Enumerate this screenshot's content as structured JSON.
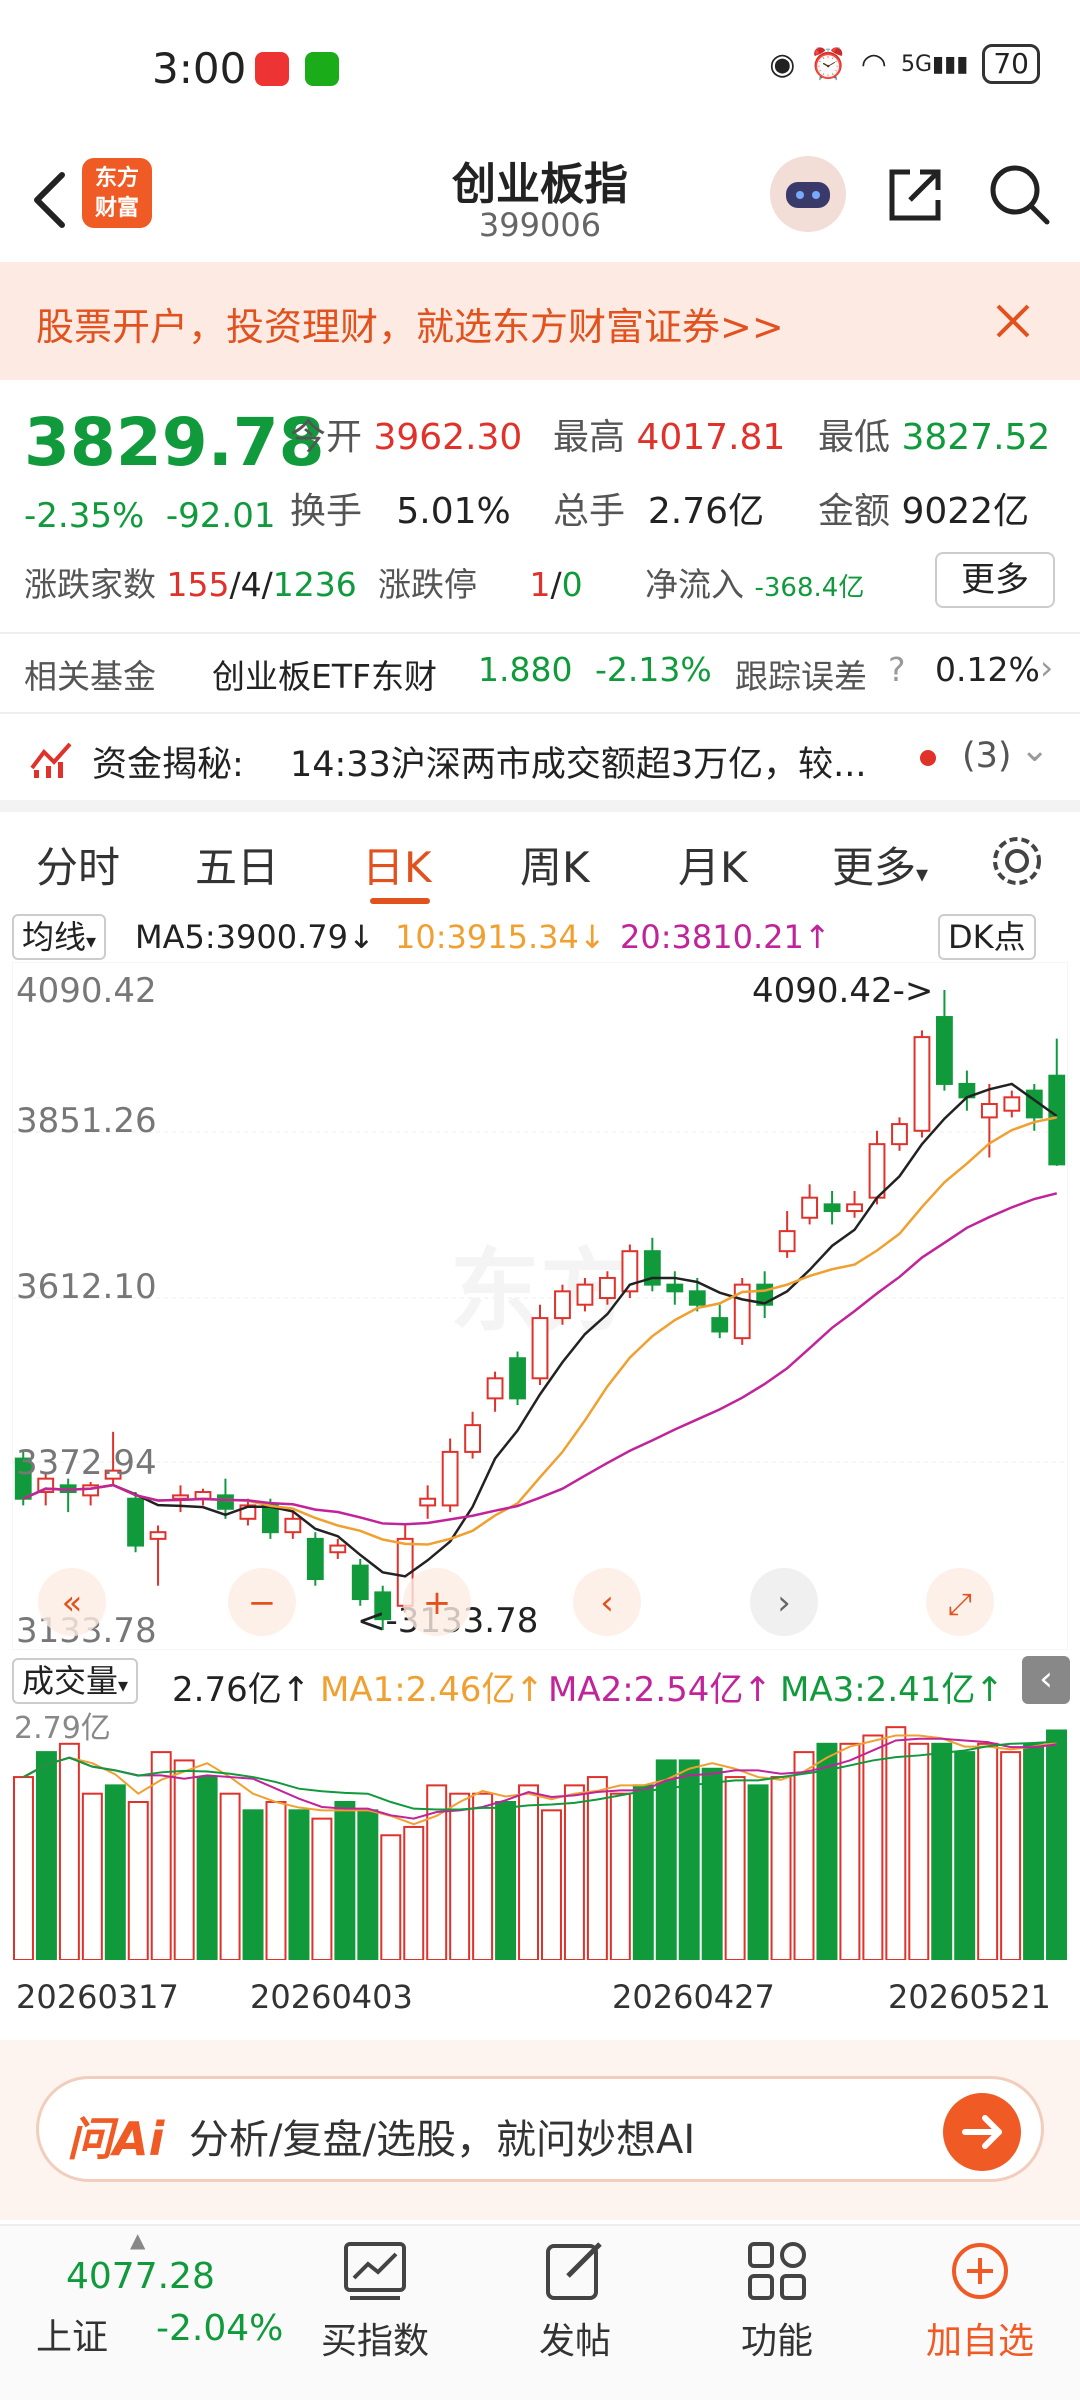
{
  "status_bar": {
    "time": "3:00",
    "network": "5G",
    "battery": "70"
  },
  "header": {
    "title": "创业板指",
    "code": "399006",
    "logo_text_1": "东方",
    "logo_text_2": "财富"
  },
  "promo": {
    "text": "股票开户，投资理财，就选东方财富证券>>"
  },
  "quote": {
    "price": "3829.78",
    "change_pct": "-2.35%",
    "change_abs": "-92.01",
    "open_label": "今开",
    "open": "3962.30",
    "high_label": "最高",
    "high": "4017.81",
    "low_label": "最低",
    "low": "3827.52",
    "turnover_label": "换手",
    "turnover": "5.01%",
    "volume_label": "总手",
    "volume": "2.76亿",
    "amount_label": "金额",
    "amount": "9022亿",
    "breadth_label": "涨跌家数",
    "breadth_up": "155",
    "breadth_flat": "4",
    "breadth_down": "1236",
    "limit_label": "涨跌停",
    "limit_up": "1",
    "limit_down": "0",
    "netflow_label": "净流入",
    "netflow": "-368.4亿",
    "more_label": "更多"
  },
  "fund": {
    "label": "相关基金",
    "name": "创业板ETF东财",
    "price": "1.880",
    "change": "-2.13%",
    "tracking_label": "跟踪误差",
    "tracking_value": "0.12%"
  },
  "news": {
    "label": "资金揭秘:",
    "text": "14:33沪深两市成交额超3万亿，较...",
    "count": "(3)"
  },
  "tabs": [
    "分时",
    "五日",
    "日K",
    "周K",
    "月K",
    "更多"
  ],
  "ma_legend": {
    "selector": "均线",
    "ma5": "MA5:3900.79",
    "ma10": "10:3915.34",
    "ma20": "20:3810.21",
    "dk": "DK点"
  },
  "y_ticks": [
    "4090.42",
    "3851.26",
    "3612.10",
    "3372.94",
    "3133.78"
  ],
  "annotations": {
    "high": "4090.42->",
    "low": "<-3133.78"
  },
  "volume_legend": {
    "selector": "成交量",
    "vol": "2.76亿",
    "ma1": "MA1:2.46亿",
    "ma2": "MA2:2.54亿",
    "ma3": "MA3:2.41亿",
    "top": "2.79亿"
  },
  "dates": [
    "20260317",
    "20260403",
    "20260427",
    "20260521"
  ],
  "colors": {
    "up": "#e0312a",
    "down": "#109a3c",
    "ma5": "#222222",
    "ma10": "#f0a030",
    "ma20": "#c0239a",
    "accent": "#f05a24"
  },
  "ai_bar": {
    "logo": "问Ai",
    "placeholder": "分析/复盘/选股，就问妙想AI"
  },
  "bottom_nav": {
    "index_value": "4077.28",
    "index_name": "上证",
    "index_change": "-2.04%",
    "buy": "买指数",
    "post": "发帖",
    "func": "功能",
    "add": "加自选"
  },
  "chart_data": {
    "type": "candlestick",
    "y_range": [
      3133.78,
      4090.42
    ],
    "candles": [
      {
        "o": 3390,
        "c": 3330,
        "h": 3400,
        "l": 3320
      },
      {
        "o": 3340,
        "c": 3360,
        "h": 3370,
        "l": 3320
      },
      {
        "o": 3350,
        "c": 3340,
        "h": 3360,
        "l": 3310
      },
      {
        "o": 3335,
        "c": 3350,
        "h": 3355,
        "l": 3320
      },
      {
        "o": 3360,
        "c": 3372,
        "h": 3430,
        "l": 3350
      },
      {
        "o": 3330,
        "c": 3260,
        "h": 3340,
        "l": 3250
      },
      {
        "o": 3270,
        "c": 3280,
        "h": 3290,
        "l": 3200
      },
      {
        "o": 3330,
        "c": 3335,
        "h": 3350,
        "l": 3310
      },
      {
        "o": 3330,
        "c": 3340,
        "h": 3345,
        "l": 3320
      },
      {
        "o": 3335,
        "c": 3315,
        "h": 3360,
        "l": 3300
      },
      {
        "o": 3300,
        "c": 3320,
        "h": 3330,
        "l": 3290
      },
      {
        "o": 3320,
        "c": 3280,
        "h": 3330,
        "l": 3270
      },
      {
        "o": 3280,
        "c": 3300,
        "h": 3310,
        "l": 3270
      },
      {
        "o": 3270,
        "c": 3210,
        "h": 3280,
        "l": 3200
      },
      {
        "o": 3250,
        "c": 3260,
        "h": 3270,
        "l": 3240
      },
      {
        "o": 3230,
        "c": 3180,
        "h": 3240,
        "l": 3170
      },
      {
        "o": 3190,
        "c": 3150,
        "h": 3200,
        "l": 3133.78
      },
      {
        "o": 3170,
        "c": 3270,
        "h": 3290,
        "l": 3160
      },
      {
        "o": 3320,
        "c": 3330,
        "h": 3350,
        "l": 3300
      },
      {
        "o": 3320,
        "c": 3400,
        "h": 3420,
        "l": 3310
      },
      {
        "o": 3400,
        "c": 3440,
        "h": 3460,
        "l": 3390
      },
      {
        "o": 3480,
        "c": 3510,
        "h": 3520,
        "l": 3460
      },
      {
        "o": 3540,
        "c": 3480,
        "h": 3550,
        "l": 3470
      },
      {
        "o": 3510,
        "c": 3600,
        "h": 3620,
        "l": 3500
      },
      {
        "o": 3600,
        "c": 3640,
        "h": 3650,
        "l": 3590
      },
      {
        "o": 3620,
        "c": 3650,
        "h": 3660,
        "l": 3610
      },
      {
        "o": 3630,
        "c": 3660,
        "h": 3670,
        "l": 3620
      },
      {
        "o": 3640,
        "c": 3700,
        "h": 3710,
        "l": 3630
      },
      {
        "o": 3700,
        "c": 3650,
        "h": 3720,
        "l": 3640
      },
      {
        "o": 3650,
        "c": 3640,
        "h": 3670,
        "l": 3620
      },
      {
        "o": 3640,
        "c": 3620,
        "h": 3660,
        "l": 3610
      },
      {
        "o": 3600,
        "c": 3580,
        "h": 3620,
        "l": 3570
      },
      {
        "o": 3570,
        "c": 3650,
        "h": 3660,
        "l": 3560
      },
      {
        "o": 3650,
        "c": 3620,
        "h": 3670,
        "l": 3600
      },
      {
        "o": 3700,
        "c": 3730,
        "h": 3760,
        "l": 3690
      },
      {
        "o": 3750,
        "c": 3780,
        "h": 3800,
        "l": 3740
      },
      {
        "o": 3770,
        "c": 3760,
        "h": 3790,
        "l": 3740
      },
      {
        "o": 3760,
        "c": 3770,
        "h": 3790,
        "l": 3750
      },
      {
        "o": 3780,
        "c": 3860,
        "h": 3880,
        "l": 3770
      },
      {
        "o": 3860,
        "c": 3890,
        "h": 3900,
        "l": 3850
      },
      {
        "o": 3880,
        "c": 4020,
        "h": 4030,
        "l": 3870
      },
      {
        "o": 4050,
        "c": 3950,
        "h": 4090.42,
        "l": 3940
      },
      {
        "o": 3950,
        "c": 3930,
        "h": 3970,
        "l": 3910
      },
      {
        "o": 3900,
        "c": 3920,
        "h": 3950,
        "l": 3840
      },
      {
        "o": 3910,
        "c": 3930,
        "h": 3940,
        "l": 3900
      },
      {
        "o": 3940,
        "c": 3900,
        "h": 3950,
        "l": 3880
      },
      {
        "o": 3962.3,
        "c": 3829.78,
        "h": 4017.81,
        "l": 3827.52
      }
    ],
    "volumes": [
      2.2,
      2.5,
      2.6,
      2.0,
      2.1,
      1.9,
      2.5,
      2.4,
      2.2,
      2.0,
      1.8,
      1.9,
      1.8,
      1.7,
      1.9,
      1.8,
      1.5,
      1.6,
      2.1,
      2.0,
      2.0,
      1.9,
      2.1,
      1.8,
      2.1,
      2.2,
      2.0,
      2.1,
      2.4,
      2.4,
      2.3,
      2.2,
      2.1,
      2.2,
      2.5,
      2.6,
      2.6,
      2.7,
      2.8,
      2.6,
      2.6,
      2.5,
      2.6,
      2.5,
      2.6,
      2.76
    ]
  }
}
